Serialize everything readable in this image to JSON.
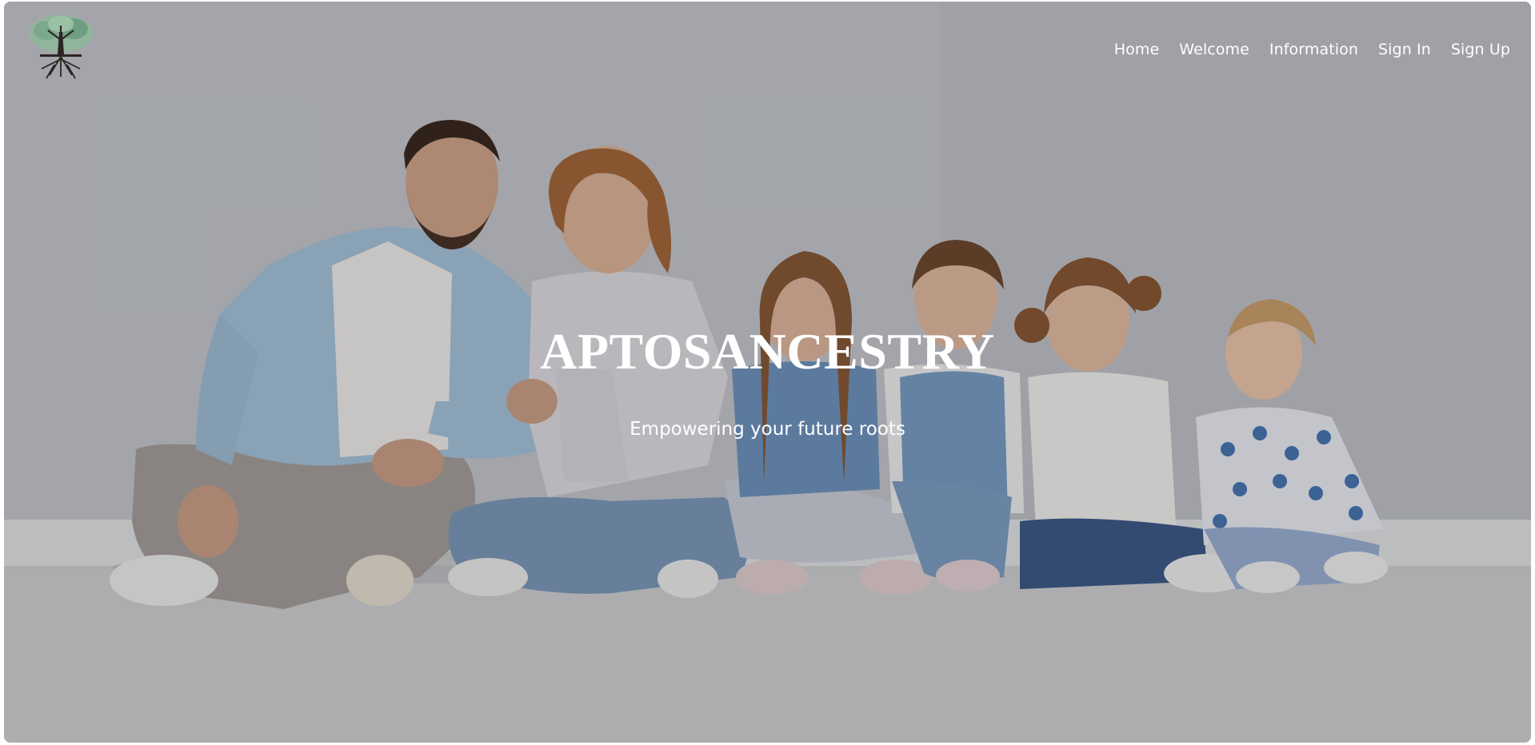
{
  "nav": {
    "items": [
      {
        "label": "Home"
      },
      {
        "label": "Welcome"
      },
      {
        "label": "Information"
      },
      {
        "label": "Sign In"
      },
      {
        "label": "Sign Up"
      }
    ]
  },
  "hero": {
    "title": "APTOSANCESTRY",
    "tagline": "Empowering your future roots",
    "overlay_color": "#000000"
  },
  "logo": {
    "icon": "family-tree-logo-icon"
  },
  "colors": {
    "nav_text": "#ffffff",
    "title_text": "#ffffff",
    "wall": "#c9ccd2",
    "floor": "#cfd1d3"
  }
}
